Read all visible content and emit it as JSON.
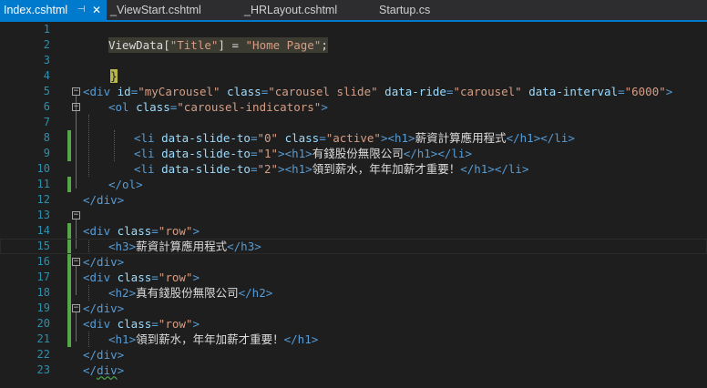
{
  "tabs": [
    {
      "label": "Index.cshtml",
      "active": true
    },
    {
      "label": "_ViewStart.cshtml",
      "active": false
    },
    {
      "label": "_HRLayout.cshtml",
      "active": false
    },
    {
      "label": "Startup.cs",
      "active": false
    }
  ],
  "tab_icons": {
    "pin": "pin-icon",
    "close": "close-icon"
  },
  "line_numbers": [
    "1",
    "2",
    "3",
    "4",
    "5",
    "6",
    "7",
    "8",
    "9",
    "10",
    "11",
    "12",
    "13",
    "14",
    "15",
    "16",
    "17",
    "18",
    "19",
    "20",
    "21",
    "22",
    "23"
  ],
  "code": {
    "l1_razor": "@{",
    "l2_viewdata": "ViewData[",
    "l2_key": "\"Title\"",
    "l2_rest": "] = ",
    "l2_value": "\"Home Page\"",
    "l2_semi": ";",
    "l3_razor": "}",
    "l5": {
      "open": "<div",
      "a1": " id",
      "eq1": "=",
      "v1": "\"myCarousel\"",
      "a2": " class",
      "eq2": "=",
      "v2": "\"carousel slide\"",
      "a3": " data-ride",
      "eq3": "=",
      "v3": "\"carousel\"",
      "a4": " data-interval",
      "eq4": "=",
      "v4": "\"6000\"",
      "close": ">"
    },
    "l6": {
      "open": "<ol",
      "a1": " class",
      "eq1": "=",
      "v1": "\"carousel-indicators\"",
      "close": ">"
    },
    "l7": {
      "open": "<li",
      "a1": " data-slide-to",
      "eq1": "=",
      "v1": "\"0\"",
      "a2": " class",
      "eq2": "=",
      "v2": "\"active\"",
      "close": ">",
      "h_open": "<h1>",
      "text": "薪資計算應用程式",
      "h_close": "</h1>",
      "li_close": "</li>"
    },
    "l8": {
      "open": "<li",
      "a1": " data-slide-to",
      "eq1": "=",
      "v1": "\"1\"",
      "close": ">",
      "h_open": "<h1>",
      "text": "有錢股份無限公司",
      "h_close": "</h1>",
      "li_close": "</li>"
    },
    "l9": {
      "open": "<li",
      "a1": " data-slide-to",
      "eq1": "=",
      "v1": "\"2\"",
      "close": ">",
      "h_open": "<h1>",
      "text": "領到薪水，年年加薪才重要！",
      "h_close": "</h1>",
      "li_close": "</li>"
    },
    "l10": "</ol>",
    "l11": "</div>",
    "l13": {
      "open": "<div",
      "a1": " class",
      "eq1": "=",
      "v1": "\"row\"",
      "close": ">"
    },
    "l14": {
      "h_open": "<h3>",
      "text": "薪資計算應用程式",
      "h_close": "</h3>"
    },
    "l15": "</div>",
    "l16": {
      "open": "<div",
      "a1": " class",
      "eq1": "=",
      "v1": "\"row\"",
      "close": ">"
    },
    "l17": {
      "h_open": "<h2>",
      "text": "真有錢股份無限公司",
      "h_close": "</h2>"
    },
    "l18": "</div>",
    "l19": {
      "open": "<div",
      "a1": " class",
      "eq1": "=",
      "v1": "\"row\"",
      "close": ">"
    },
    "l20": {
      "h_open": "<h1>",
      "text": "領到薪水，年年加薪才重要！",
      "h_close": "</h1>"
    },
    "l21": "</div>",
    "l22_open": "</",
    "l22_name": "div",
    "l22_close": ">"
  },
  "colors": {
    "tag": "#569cd6",
    "attribute": "#9cdcfe",
    "string": "#d69d85",
    "line_number": "#2b91af",
    "change_margin": "#57a64a",
    "accent": "#007acc"
  }
}
